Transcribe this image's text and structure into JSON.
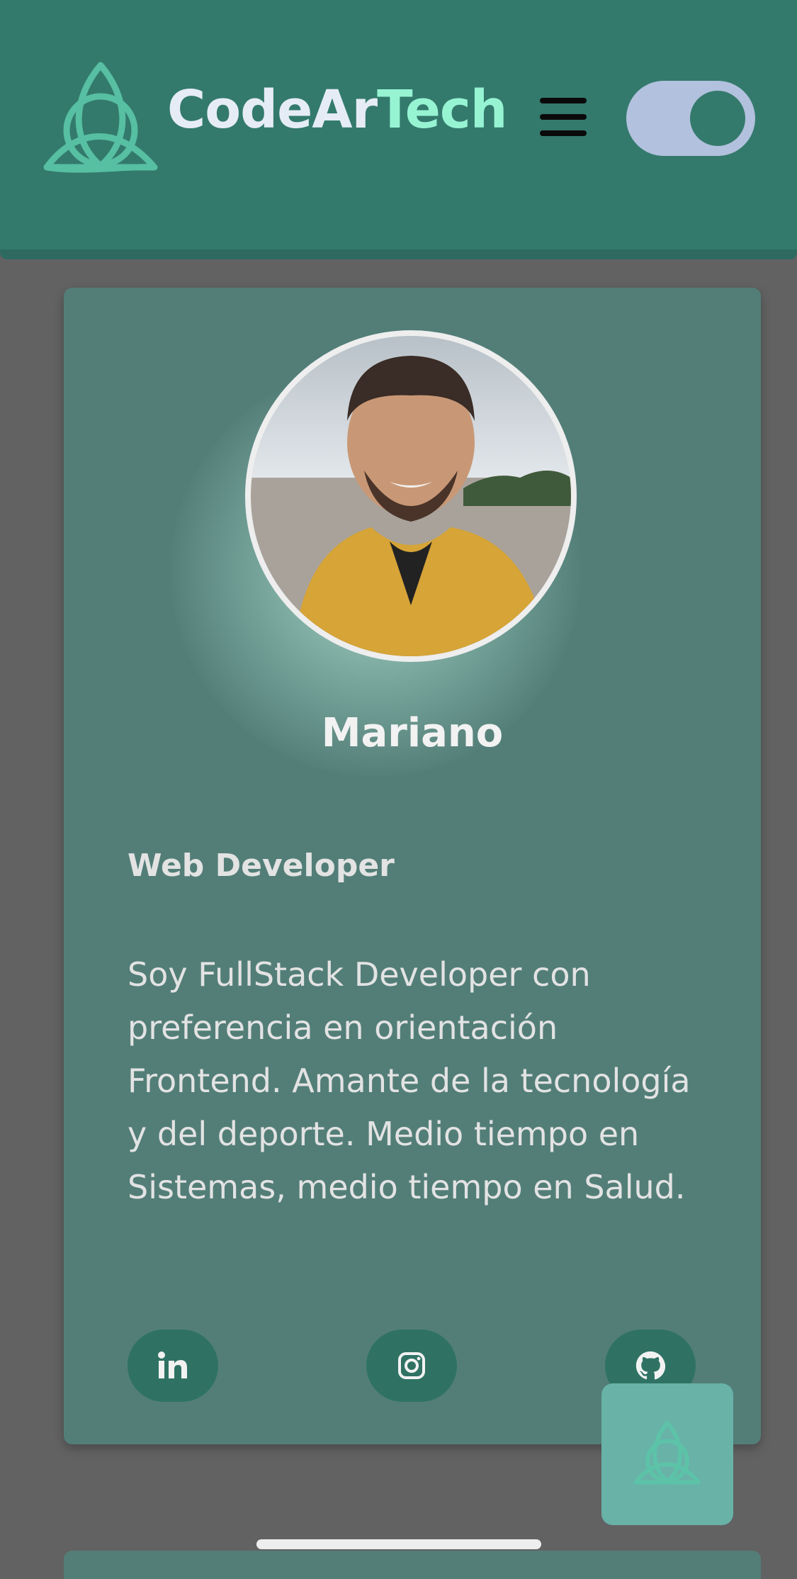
{
  "header": {
    "brand_part1": "CodeAr",
    "brand_part2": "Tech",
    "logo_icon": "triquetra-icon",
    "menu_icon": "hamburger-menu-icon",
    "theme_toggle": {
      "state": "on"
    }
  },
  "profile": {
    "photo": "profile-photo",
    "name": "Mariano",
    "role": "Web Developer",
    "bio": "Soy FullStack Developer con preferencia en orientación Frontend. Amante de la tecnología y del deporte. Medio tiempo en Sistemas, medio tiempo en Salud.",
    "social": [
      {
        "icon": "linkedin-icon"
      },
      {
        "icon": "instagram-icon"
      },
      {
        "icon": "github-icon"
      }
    ]
  },
  "floating_button": {
    "icon": "triquetra-icon"
  },
  "colors": {
    "background": "#626262",
    "header": "#337a6c",
    "card": "#537e78",
    "brand_accent": "#97f4d3",
    "brand_text": "#e6ecf6",
    "toggle_track": "#b2c1dd",
    "floating_button": "#68b2a8"
  }
}
